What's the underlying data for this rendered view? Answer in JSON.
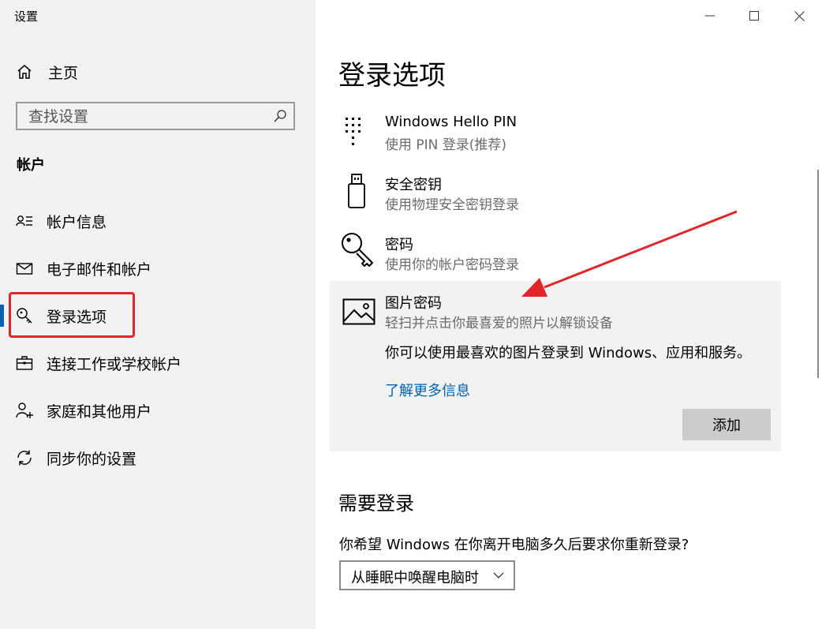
{
  "window": {
    "title": "设置",
    "controls": [
      "minimize-icon",
      "maximize-icon",
      "close-icon"
    ]
  },
  "sidebar": {
    "home_label": "主页",
    "search_placeholder": "查找设置",
    "section_heading": "帐户",
    "items": [
      {
        "label": "帐户信息",
        "icon": "account-info-icon"
      },
      {
        "label": "电子邮件和帐户",
        "icon": "mail-icon"
      },
      {
        "label": "登录选项",
        "icon": "key-icon",
        "selected": true
      },
      {
        "label": "连接工作或学校帐户",
        "icon": "briefcase-icon"
      },
      {
        "label": "家庭和其他用户",
        "icon": "add-user-icon"
      },
      {
        "label": "同步你的设置",
        "icon": "sync-icon"
      }
    ]
  },
  "main": {
    "title": "登录选项",
    "options": [
      {
        "title": "Windows Hello PIN",
        "subtitle": "使用 PIN 登录(推荐)",
        "icon": "pin-keypad-icon"
      },
      {
        "title": "安全密钥",
        "subtitle": "使用物理安全密钥登录",
        "icon": "usb-key-icon"
      },
      {
        "title": "密码",
        "subtitle": "使用你的帐户密码登录",
        "icon": "password-key-icon"
      },
      {
        "title": "图片密码",
        "subtitle": "轻扫并点击你最喜爱的照片以解锁设备",
        "icon": "picture-icon",
        "expanded": true,
        "description": "你可以使用最喜欢的图片登录到 Windows、应用和服务。",
        "link": "了解更多信息",
        "button": "添加"
      }
    ],
    "require_signin": {
      "heading": "需要登录",
      "question": "你希望 Windows 在你离开电脑多久后要求你重新登录?",
      "selected": "从睡眠中唤醒电脑时"
    }
  },
  "colors": {
    "sidebar_bg": "#f2f2f2",
    "accent": "#0063b1",
    "annotation_red": "#e0262a",
    "link": "#0063b1"
  }
}
